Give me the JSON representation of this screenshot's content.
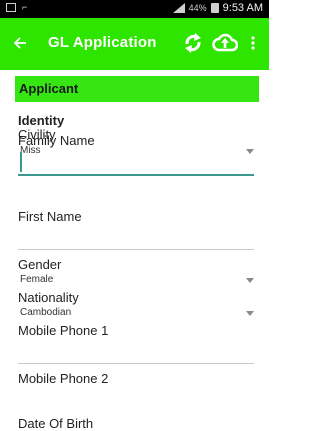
{
  "status_bar": {
    "battery_percent": "44%",
    "time": "9:53 AM",
    "icons": [
      "gallery-icon",
      "voicemail-icon",
      "signal-icon",
      "battery-icon"
    ]
  },
  "app_bar": {
    "title": "GL Application",
    "color": "#2ee500",
    "icons": [
      "back-arrow-icon",
      "sync-icon",
      "cloud-upload-icon",
      "more-vert-icon"
    ]
  },
  "section": {
    "title": "Applicant",
    "color": "#35e612"
  },
  "form": {
    "identity_heading": "Identity",
    "civility": {
      "label": "Civility",
      "value": "Miss"
    },
    "family_name": {
      "label": "Family Name",
      "value": ""
    },
    "first_name": {
      "label": "First Name",
      "value": ""
    },
    "gender": {
      "label": "Gender",
      "value": "Female"
    },
    "nationality": {
      "label": "Nationality",
      "value": "Cambodian"
    },
    "mobile_phone_1": {
      "label": "Mobile Phone 1",
      "value": ""
    },
    "mobile_phone_2": {
      "label": "Mobile Phone 2",
      "value": ""
    },
    "date_of_birth": {
      "label": "Date Of Birth"
    }
  }
}
